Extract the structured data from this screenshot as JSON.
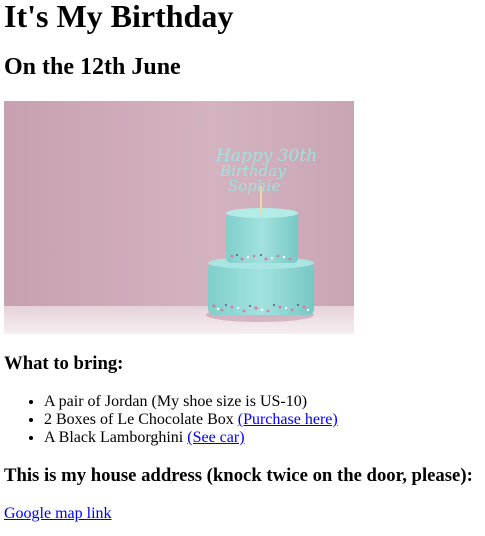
{
  "header": {
    "title": "It's My Birthday",
    "date_line": "On the 12th June"
  },
  "hero_image": {
    "alt": "Two-tier turquoise birthday cake with topper",
    "topper_text": [
      "Happy 30th",
      "Birthday",
      "Sophie"
    ],
    "colors": {
      "background": "#c9a7b5",
      "frosting": "#8fd6d2",
      "table": "#f3e9ee"
    }
  },
  "bring": {
    "title": "What to bring:",
    "items": [
      {
        "text": "A pair of Jordan (My shoe size is US-10)",
        "link": ""
      },
      {
        "text": "2 Boxes of Le Chocolate Box ",
        "link": "(Purchase here)"
      },
      {
        "text": "A Black Lamborghini ",
        "link": "(See car)"
      }
    ]
  },
  "address": {
    "title": "This is my house address (knock twice on the door, please):",
    "map_link": "Google map link"
  }
}
